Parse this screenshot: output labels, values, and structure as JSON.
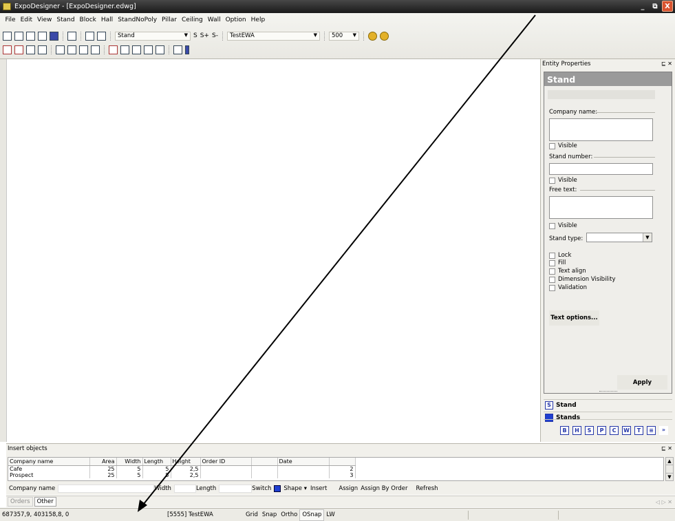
{
  "window": {
    "title": "ExpoDesigner - [ExpoDesigner.edwg]",
    "controls": [
      "_",
      "⧉",
      "X"
    ]
  },
  "menu": [
    "File",
    "Edit",
    "View",
    "Stand",
    "Block",
    "Hall",
    "StandNoPoly",
    "Pillar",
    "Ceiling",
    "Wall",
    "Option",
    "Help"
  ],
  "toolbar": {
    "stand_combo": "Stand",
    "stand_buttons": [
      "S",
      "S+",
      "S-"
    ],
    "layer_combo": "TestEWA",
    "zoom_combo": "500"
  },
  "entity_panel": {
    "header": "Entity Properties",
    "header_controls": "⊑ ✕",
    "title": "Stand",
    "company_name_label": "Company name:",
    "visible_label": "Visible",
    "stand_number_label": "Stand number:",
    "free_text_label": "Free text:",
    "stand_type_label": "Stand type:",
    "options": [
      "Lock",
      "Fill",
      "Text align",
      "Dimension Visibility",
      "Validation"
    ],
    "text_options_button": "Text options...",
    "apply_button": "Apply",
    "nav_items": [
      {
        "icon": "S",
        "label": "Stand"
      },
      {
        "icon": "",
        "label": "Stands"
      }
    ],
    "nav_strip": [
      "B",
      "H",
      "S",
      "P",
      "C",
      "W",
      "T",
      "≡",
      "»"
    ]
  },
  "insert_panel": {
    "header": "Insert objects",
    "columns": [
      "Company name",
      "Area",
      "Width",
      "Length",
      "Height",
      "Order ID",
      "",
      "Date",
      ""
    ],
    "rows": [
      [
        "Cafe",
        "25",
        "5",
        "5",
        "2,5",
        "",
        "",
        "",
        "2"
      ],
      [
        "Prospect",
        "25",
        "5",
        "5",
        "2,5",
        "",
        "",
        "",
        "3"
      ]
    ],
    "form": {
      "company_name": "Company name",
      "width": "Width",
      "length": "Length",
      "switch": "Switch",
      "shape": "Shape ▾",
      "insert": "Insert",
      "assign": "Assign",
      "assign_by_order": "Assign By Order",
      "refresh": "Refresh"
    }
  },
  "tabs": [
    "Orders",
    "Other"
  ],
  "tab_arrows": "◁ ▷ ✕",
  "status": {
    "coords": "687357,9, 403158,8, 0",
    "layer": "[5555] TestEWA",
    "toggles": [
      "Grid",
      "Snap",
      "Ortho",
      "OSnap",
      "LW"
    ]
  },
  "colors": {
    "titlebar": "#2a2a2a",
    "accent": "#1f3fd0",
    "close": "#d9532f"
  }
}
